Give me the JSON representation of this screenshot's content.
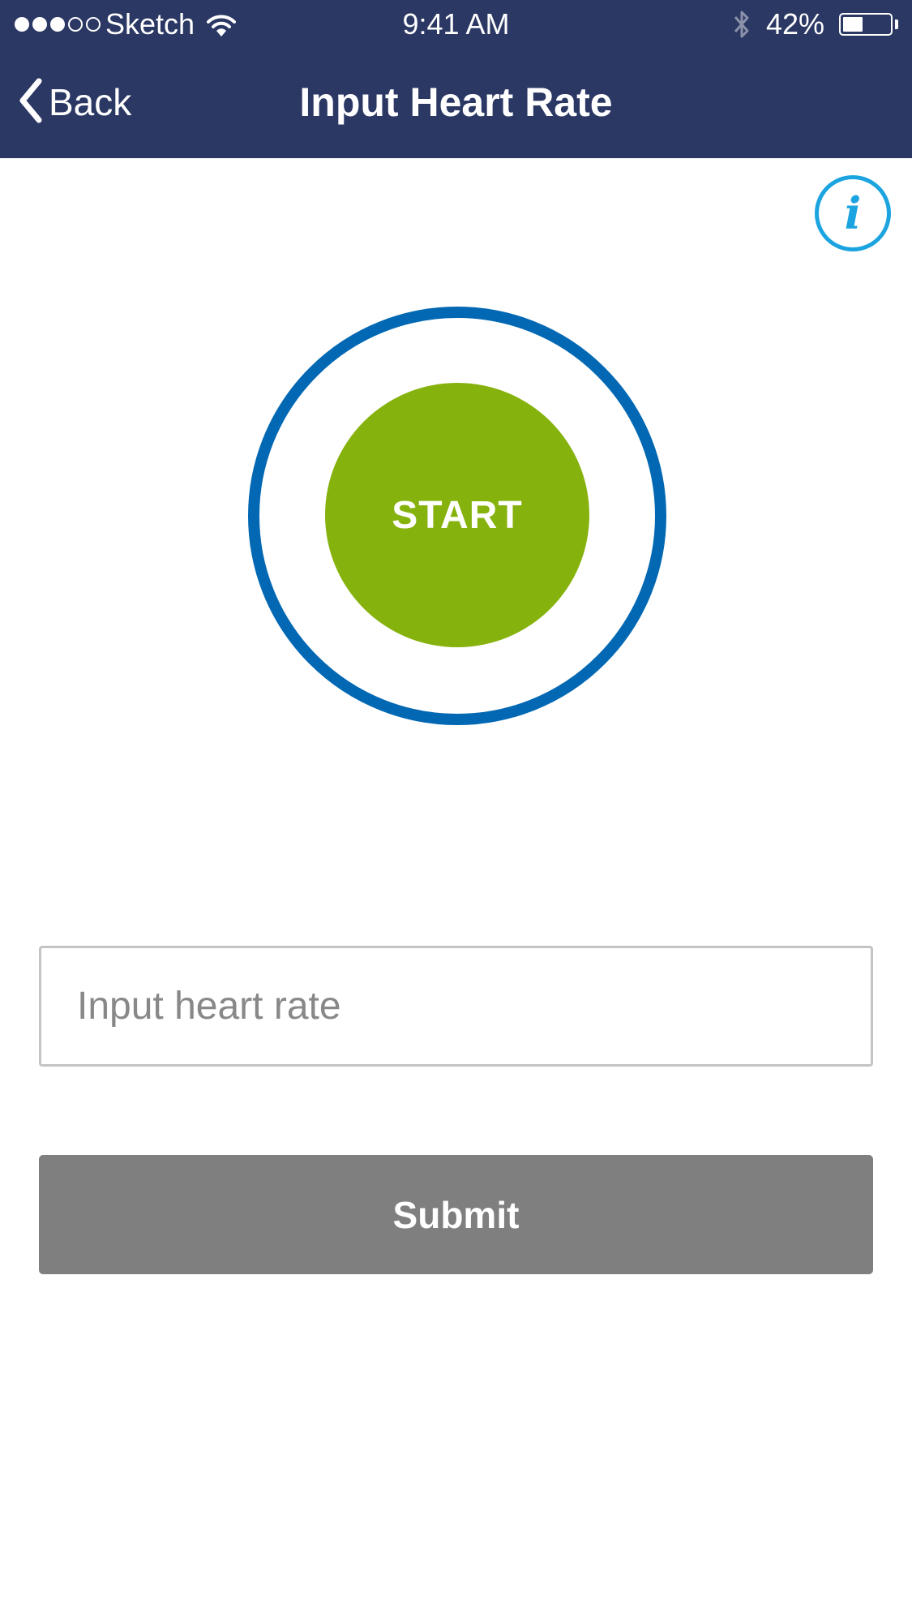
{
  "status_bar": {
    "carrier": "Sketch",
    "time": "9:41 AM",
    "battery_percent": "42%",
    "battery_level": 0.42,
    "signal_strength": 3,
    "icons": [
      "wifi-icon",
      "bluetooth-icon",
      "battery-icon"
    ]
  },
  "nav": {
    "back_label": "Back",
    "title": "Input Heart Rate",
    "info_icon": "info-icon",
    "info_glyph": "i"
  },
  "main": {
    "start_label": "START",
    "input_placeholder": "Input heart rate",
    "input_value": "",
    "submit_label": "Submit"
  },
  "colors": {
    "header": "#2b3864",
    "ring": "#0268b3",
    "start": "#86b20d",
    "info": "#1ba4df",
    "submit": "#7f7f7f"
  }
}
